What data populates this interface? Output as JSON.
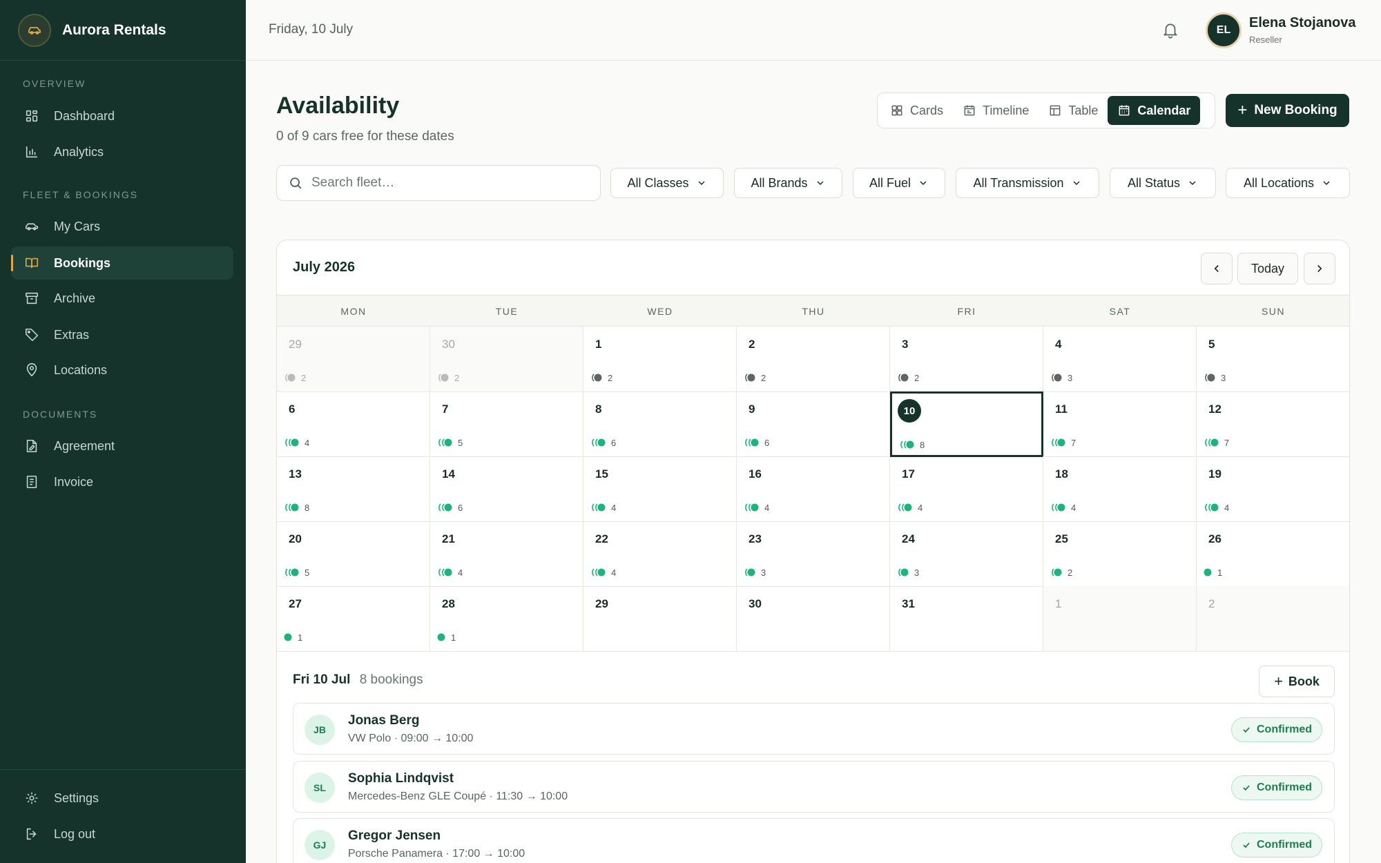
{
  "app": {
    "name": "Aurora Rentals"
  },
  "sidebar": {
    "sections": [
      {
        "label": "OVERVIEW"
      },
      {
        "label": "FLEET & BOOKINGS"
      },
      {
        "label": "DOCUMENTS"
      }
    ],
    "items": [
      {
        "label": "Dashboard",
        "icon": "grid-icon"
      },
      {
        "label": "Analytics",
        "icon": "bar-chart-icon"
      },
      {
        "label": "My Cars",
        "icon": "car-icon"
      },
      {
        "label": "Bookings",
        "icon": "book-icon",
        "active": true
      },
      {
        "label": "Archive",
        "icon": "archive-icon"
      },
      {
        "label": "Extras",
        "icon": "tag-icon"
      },
      {
        "label": "Locations",
        "icon": "map-pin-icon"
      },
      {
        "label": "Agreement",
        "icon": "file-edit-icon"
      },
      {
        "label": "Invoice",
        "icon": "receipt-icon"
      }
    ],
    "footer": [
      {
        "label": "Settings",
        "icon": "gear-icon"
      },
      {
        "label": "Log out",
        "icon": "logout-icon"
      }
    ]
  },
  "topbar": {
    "date": "Friday, 10 July",
    "user": {
      "initials": "EL",
      "name": "Elena Stojanova",
      "role": "Reseller"
    }
  },
  "page": {
    "title": "Availability",
    "subtitle": "0 of 9 cars free for these dates",
    "views": [
      {
        "label": "Cards",
        "icon": "cards-icon"
      },
      {
        "label": "Timeline",
        "icon": "timeline-icon"
      },
      {
        "label": "Table",
        "icon": "table-icon"
      },
      {
        "label": "Calendar",
        "icon": "calendar-icon",
        "active": true
      }
    ],
    "new_booking_label": "New Booking"
  },
  "search": {
    "placeholder": "Search fleet…",
    "value": ""
  },
  "filters": [
    "All Classes",
    "All Brands",
    "All Fuel",
    "All Transmission",
    "All Status",
    "All Locations"
  ],
  "calendar": {
    "month_label": "July 2026",
    "today_label": "Today",
    "weekdays": [
      "MON",
      "TUE",
      "WED",
      "THU",
      "FRI",
      "SAT",
      "SUN"
    ],
    "weeks": [
      [
        {
          "d": "29",
          "n": "2",
          "other": true
        },
        {
          "d": "30",
          "n": "2",
          "other": true
        },
        {
          "d": "1",
          "n": "2"
        },
        {
          "d": "2",
          "n": "2"
        },
        {
          "d": "3",
          "n": "2"
        },
        {
          "d": "4",
          "n": "3"
        },
        {
          "d": "5",
          "n": "3"
        }
      ],
      [
        {
          "d": "6",
          "n": "4"
        },
        {
          "d": "7",
          "n": "5"
        },
        {
          "d": "8",
          "n": "6"
        },
        {
          "d": "9",
          "n": "6"
        },
        {
          "d": "10",
          "n": "8",
          "today": true
        },
        {
          "d": "11",
          "n": "7"
        },
        {
          "d": "12",
          "n": "7"
        }
      ],
      [
        {
          "d": "13",
          "n": "8"
        },
        {
          "d": "14",
          "n": "6"
        },
        {
          "d": "15",
          "n": "4"
        },
        {
          "d": "16",
          "n": "4"
        },
        {
          "d": "17",
          "n": "4"
        },
        {
          "d": "18",
          "n": "4"
        },
        {
          "d": "19",
          "n": "4"
        }
      ],
      [
        {
          "d": "20",
          "n": "5"
        },
        {
          "d": "21",
          "n": "4"
        },
        {
          "d": "22",
          "n": "4"
        },
        {
          "d": "23",
          "n": "3"
        },
        {
          "d": "24",
          "n": "3"
        },
        {
          "d": "25",
          "n": "2"
        },
        {
          "d": "26",
          "n": "1"
        }
      ],
      [
        {
          "d": "27",
          "n": "1"
        },
        {
          "d": "28",
          "n": "1"
        },
        {
          "d": "29"
        },
        {
          "d": "30"
        },
        {
          "d": "31"
        },
        {
          "d": "1",
          "other": true
        },
        {
          "d": "2",
          "other": true
        }
      ]
    ],
    "colors": {
      "available": "#1cb47a",
      "busy": "#5d6662",
      "muted": "#b7bdb9"
    }
  },
  "day_panel": {
    "date_label": "Fri 10 Jul",
    "count_label": "8 bookings",
    "book_label": "Book",
    "bookings": [
      {
        "initials": "JB",
        "name": "Jonas Berg",
        "detail": "VW Polo · 09:00 → 10:00",
        "status": "Confirmed"
      },
      {
        "initials": "SL",
        "name": "Sophia Lindqvist",
        "detail": "Mercedes-Benz GLE Coupé · 11:30 → 10:00",
        "status": "Confirmed"
      },
      {
        "initials": "GJ",
        "name": "Gregor Jensen",
        "detail": "Porsche Panamera · 17:00 → 10:00",
        "status": "Confirmed"
      }
    ]
  }
}
